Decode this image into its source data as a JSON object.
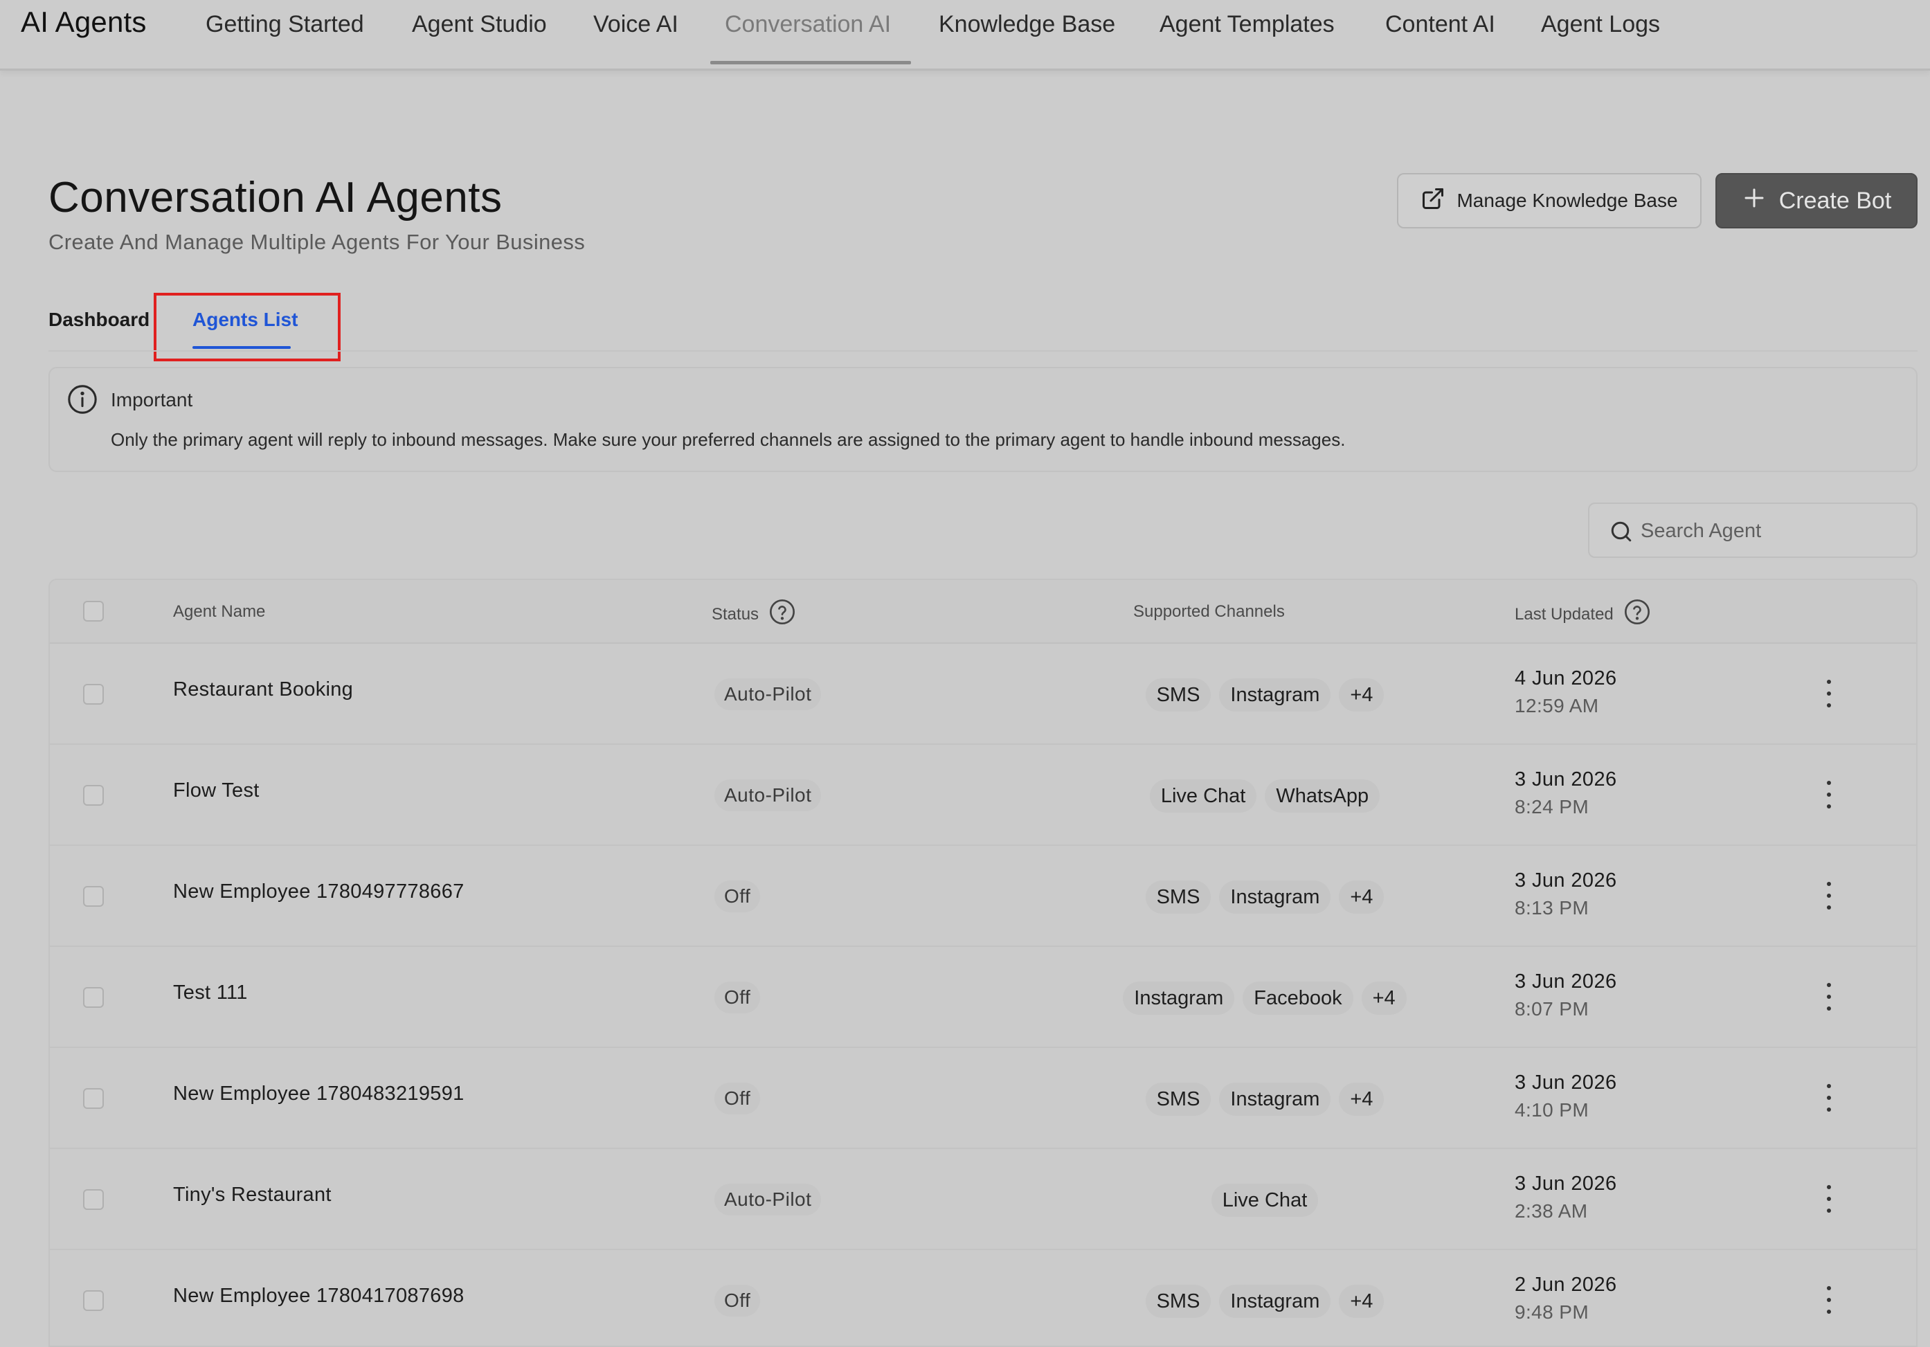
{
  "app": {
    "title": "AI Agents"
  },
  "nav": {
    "tabs": [
      {
        "label": "Getting Started"
      },
      {
        "label": "Agent Studio"
      },
      {
        "label": "Voice AI"
      },
      {
        "label": "Conversation AI",
        "active": true
      },
      {
        "label": "Knowledge Base"
      },
      {
        "label": "Agent Templates"
      },
      {
        "label": "Content AI"
      },
      {
        "label": "Agent Logs"
      }
    ]
  },
  "header": {
    "title": "Conversation AI Agents",
    "subtitle": "Create And Manage Multiple Agents For Your Business",
    "manage_kb_label": "Manage Knowledge Base",
    "create_bot_label": "Create Bot"
  },
  "subtabs": [
    {
      "label": "Dashboard"
    },
    {
      "label": "Agents List",
      "active": true
    }
  ],
  "notice": {
    "title": "Important",
    "body": "Only the primary agent will reply to inbound messages. Make sure your preferred channels are assigned to the primary agent to handle inbound messages."
  },
  "search": {
    "placeholder": "Search Agent",
    "value": ""
  },
  "table": {
    "headers": {
      "name": "Agent Name",
      "status": "Status",
      "channels": "Supported Channels",
      "updated": "Last Updated"
    },
    "rows": [
      {
        "name": "Restaurant Booking",
        "status": "Auto-Pilot",
        "channels": [
          "SMS",
          "Instagram",
          "+4"
        ],
        "date": "4 Jun 2026",
        "time": "12:59 AM"
      },
      {
        "name": "Flow Test",
        "status": "Auto-Pilot",
        "channels": [
          "Live Chat",
          "WhatsApp"
        ],
        "date": "3 Jun 2026",
        "time": "8:24 PM"
      },
      {
        "name": "New Employee 1780497778667",
        "status": "Off",
        "channels": [
          "SMS",
          "Instagram",
          "+4"
        ],
        "date": "3 Jun 2026",
        "time": "8:13 PM"
      },
      {
        "name": "Test 111",
        "status": "Off",
        "channels": [
          "Instagram",
          "Facebook",
          "+4"
        ],
        "date": "3 Jun 2026",
        "time": "8:07 PM"
      },
      {
        "name": "New Employee 1780483219591",
        "status": "Off",
        "channels": [
          "SMS",
          "Instagram",
          "+4"
        ],
        "date": "3 Jun 2026",
        "time": "4:10 PM"
      },
      {
        "name": "Tiny's Restaurant",
        "status": "Auto-Pilot",
        "channels": [
          "Live Chat"
        ],
        "date": "3 Jun 2026",
        "time": "2:38 AM"
      },
      {
        "name": "New Employee 1780417087698",
        "status": "Off",
        "channels": [
          "SMS",
          "Instagram",
          "+4"
        ],
        "date": "2 Jun 2026",
        "time": "9:48 PM"
      }
    ]
  },
  "icons": {
    "manage_kb": "external-link-icon",
    "create_bot": "plus-icon",
    "notice": "info-icon",
    "search": "search-icon",
    "help": "question-circle-icon",
    "row_menu": "more-vertical-icon"
  },
  "colors": {
    "active_subtab": "#1f55d6",
    "highlight": "#e0201f",
    "primary_button": "#555555"
  }
}
